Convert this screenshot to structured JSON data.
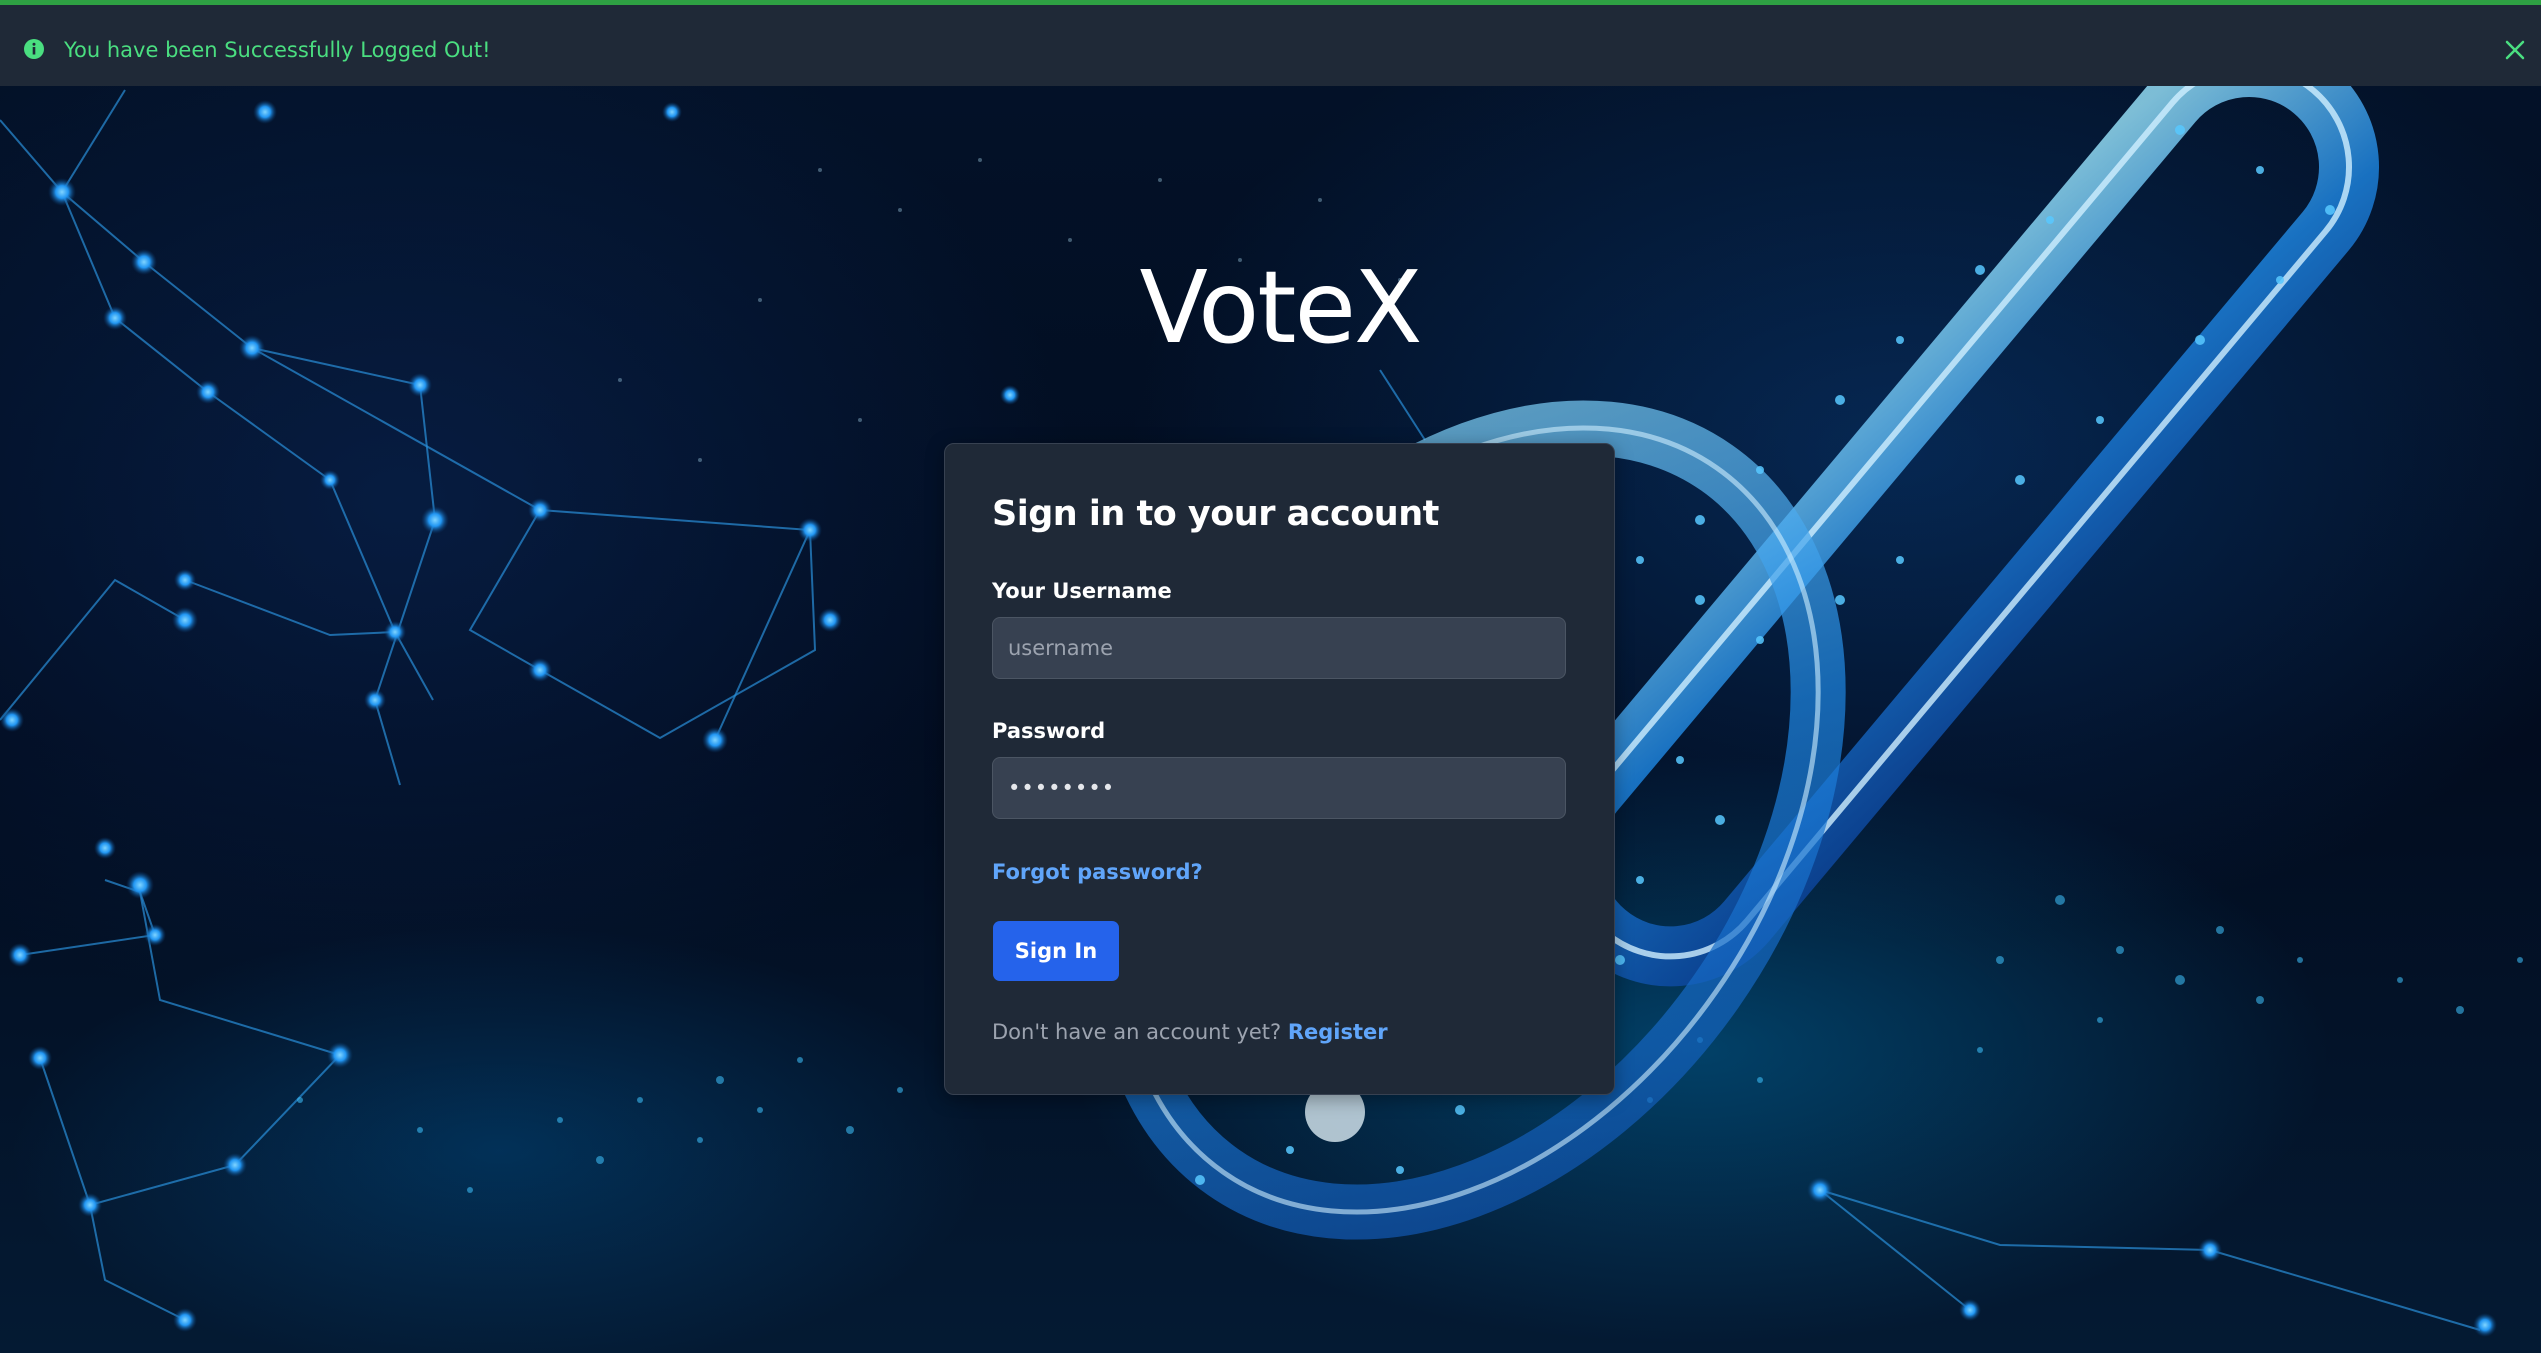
{
  "alert": {
    "icon": "info-circle-icon",
    "message": "You have been Successfully Logged Out!",
    "close_icon": "close-x-icon",
    "color": "#4ade80",
    "border_color": "#2ea043"
  },
  "brand": {
    "title": "VoteX"
  },
  "login": {
    "heading": "Sign in to your account",
    "username_label": "Your Username",
    "username_placeholder": "username",
    "username_value": "",
    "password_label": "Password",
    "password_value": "••••••••",
    "forgot_password": "Forgot password?",
    "signin_button": "Sign In",
    "register_prompt": "Don't have an account yet?",
    "register_link": "Register"
  },
  "colors": {
    "card_background": "#1f2937",
    "input_background": "#374151",
    "primary": "#2563eb",
    "link": "#60a5fa"
  }
}
